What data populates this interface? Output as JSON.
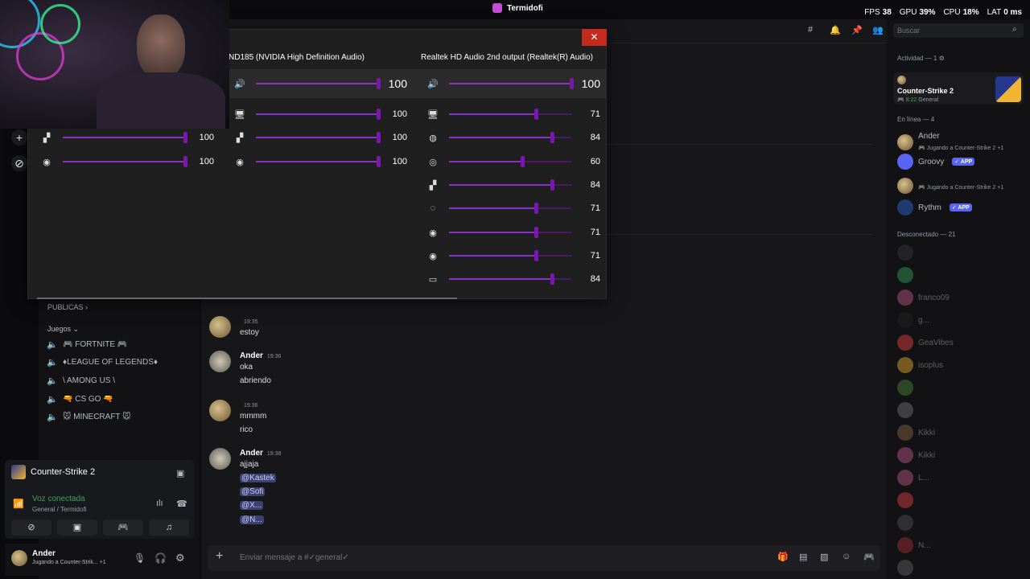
{
  "app": {
    "title": "Termidofi"
  },
  "perf": [
    {
      "label": "FPS",
      "value": "38"
    },
    {
      "label": "GPU",
      "value": "39%"
    },
    {
      "label": "CPU",
      "value": "18%"
    },
    {
      "label": "LAT",
      "value": "0 ms"
    }
  ],
  "channels": {
    "cat_publicas": "PUBLICAS ›",
    "cat_juegos": "Juegos ⌄",
    "voice": [
      "🎮 FORTNITE 🎮",
      "♦LEAGUE OF LEGENDS♦",
      "\\ AMONG US \\",
      "🔫 CS GO 🔫",
      "🐭 MINECRAFT 🐭"
    ]
  },
  "voice_panel": {
    "game": "Counter-Strike 2",
    "status": "Voz conectada",
    "sub": "General / Termidofi"
  },
  "user": {
    "name": "Ander",
    "status": "Jugando a Counter-Strik...",
    "extra": "+1"
  },
  "messages": [
    {
      "name": "",
      "time": "19:35",
      "lines": [
        "estoy"
      ]
    },
    {
      "name": "Ander",
      "time": "19:36",
      "lines": [
        "oka",
        "abriendo"
      ]
    },
    {
      "name": "",
      "time": "19:36",
      "lines": [
        "mmmm",
        "rico"
      ]
    },
    {
      "name": "Ander",
      "time": "19:38",
      "lines": [
        "ajjaja"
      ],
      "mentions": [
        "@Kastek",
        "@Sofi",
        "@X...",
        "@N..."
      ]
    }
  ],
  "composer": {
    "placeholder": "Enviar mensaje a #✓general✓"
  },
  "search": {
    "placeholder": "Buscar"
  },
  "members": {
    "activity_title": "Actividad — 1 ⚙",
    "activity_game": "Counter-Strike 2",
    "activity_time": "8:22",
    "activity_channel": "General",
    "online_title": "En línea — 4",
    "online": [
      {
        "name": "Ander",
        "activity": "Jugando a Counter-Strike 2",
        "extra": "+1",
        "color": "#c9a86a"
      },
      {
        "name": "Groovy",
        "badge": "✓ APP",
        "color": "#5865f2"
      },
      {
        "name": "",
        "activity": "Jugando a Counter-Strike 2",
        "extra": "+1",
        "color": "#c9a86a"
      },
      {
        "name": "Rythm",
        "badge": "✓ APP",
        "color": "#3e82e5"
      }
    ],
    "offline_title": "Desconectado — 21",
    "offline": [
      "",
      "",
      "franco09",
      "g...",
      "GeaVibes",
      "isoplus",
      "",
      "",
      "Kikki",
      "Kikki",
      "L...",
      "",
      "",
      "N...",
      ""
    ]
  },
  "mixer": {
    "devices": [
      {
        "title": "ND185 (NVIDIA High Definition Audio)",
        "master": 100,
        "apps": [
          {
            "icon": "system-sounds-icon",
            "value": 100
          },
          {
            "icon": "cs2-icon",
            "value": 100
          },
          {
            "icon": "steam-icon",
            "value": 100
          }
        ]
      },
      {
        "title": "Realtek HD Audio 2nd output (Realtek(R) Audio)",
        "master": 100,
        "apps": [
          {
            "icon": "system-sounds-icon",
            "value": 71
          },
          {
            "icon": "discord-icon",
            "value": 84
          },
          {
            "icon": "chrome-icon",
            "value": 60
          },
          {
            "icon": "cs2-icon",
            "value": 84
          },
          {
            "icon": "obs-icon",
            "value": 71
          },
          {
            "icon": "steam-icon",
            "value": 71
          },
          {
            "icon": "steam-icon",
            "value": 71
          },
          {
            "icon": "app-window-icon",
            "value": 84
          }
        ]
      }
    ],
    "partial_device": {
      "apps": [
        {
          "icon": "cs2-icon",
          "value": 100
        },
        {
          "icon": "steam-icon",
          "value": 100
        }
      ]
    }
  }
}
